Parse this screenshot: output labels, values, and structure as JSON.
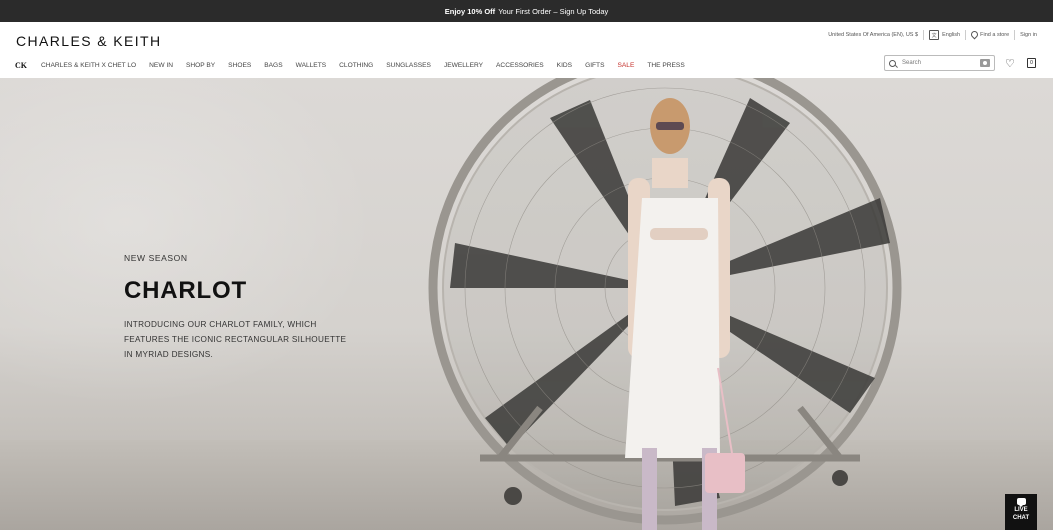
{
  "promo": {
    "bold": "Enjoy 10% Off",
    "text": "Your First Order – Sign Up Today"
  },
  "header": {
    "logo": "CHARLES & KEITH",
    "utility": {
      "region": "United States Of America (EN), US $",
      "language": "English",
      "store": "Find a store",
      "signin": "Sign in"
    },
    "nav": [
      {
        "label": "CK"
      },
      {
        "label": "CHARLES & KEITH X CHET LO"
      },
      {
        "label": "NEW IN"
      },
      {
        "label": "SHOP BY"
      },
      {
        "label": "SHOES"
      },
      {
        "label": "BAGS"
      },
      {
        "label": "WALLETS"
      },
      {
        "label": "CLOTHING"
      },
      {
        "label": "SUNGLASSES"
      },
      {
        "label": "JEWELLERY"
      },
      {
        "label": "ACCESSORIES"
      },
      {
        "label": "KIDS"
      },
      {
        "label": "GIFTS"
      },
      {
        "label": "SALE"
      },
      {
        "label": "THE PRESS"
      }
    ],
    "search": {
      "placeholder": "Search"
    },
    "bag_count": "0"
  },
  "hero": {
    "kicker": "NEW SEASON",
    "title": "CHARLOT",
    "description": "INTRODUCING OUR CHARLOT FAMILY, WHICH FEATURES THE ICONIC RECTANGULAR SILHOUETTE IN MYRIAD DESIGNS."
  },
  "chat": {
    "line1": "LIVE",
    "line2": "CHAT"
  },
  "colors": {
    "promo_bg": "#2b2b2b",
    "sale": "#c4302b",
    "accent": "#111111"
  }
}
